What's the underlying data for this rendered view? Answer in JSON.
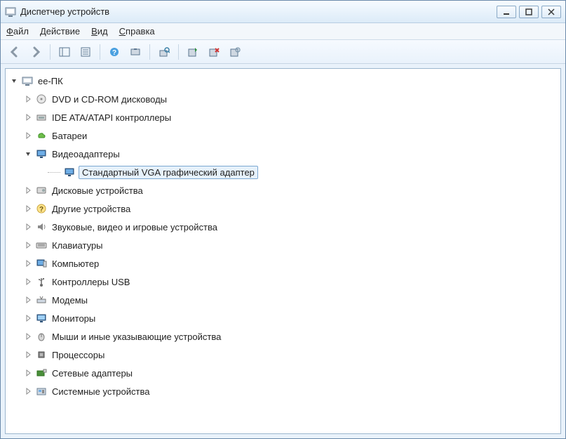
{
  "window": {
    "title": "Диспетчер устройств"
  },
  "menu": {
    "file": "Файл",
    "action": "Действие",
    "view": "Вид",
    "help": "Справка"
  },
  "tree": {
    "root": "ee-ПК",
    "items": [
      {
        "label": "DVD и CD-ROM дисководы",
        "icon": "disc"
      },
      {
        "label": "IDE ATA/ATAPI контроллеры",
        "icon": "ide"
      },
      {
        "label": "Батареи",
        "icon": "battery"
      },
      {
        "label": "Видеоадаптеры",
        "icon": "display",
        "expanded": true,
        "children": [
          {
            "label": "Стандартный VGA графический адаптер",
            "icon": "display",
            "selected": true
          }
        ]
      },
      {
        "label": "Дисковые устройства",
        "icon": "disk"
      },
      {
        "label": "Другие устройства",
        "icon": "question"
      },
      {
        "label": "Звуковые, видео и игровые устройства",
        "icon": "sound"
      },
      {
        "label": "Клавиатуры",
        "icon": "keyboard"
      },
      {
        "label": "Компьютер",
        "icon": "computer"
      },
      {
        "label": "Контроллеры USB",
        "icon": "usb"
      },
      {
        "label": "Модемы",
        "icon": "modem"
      },
      {
        "label": "Мониторы",
        "icon": "monitor"
      },
      {
        "label": "Мыши и иные указывающие устройства",
        "icon": "mouse"
      },
      {
        "label": "Процессоры",
        "icon": "cpu"
      },
      {
        "label": "Сетевые адаптеры",
        "icon": "network"
      },
      {
        "label": "Системные устройства",
        "icon": "system"
      }
    ]
  }
}
